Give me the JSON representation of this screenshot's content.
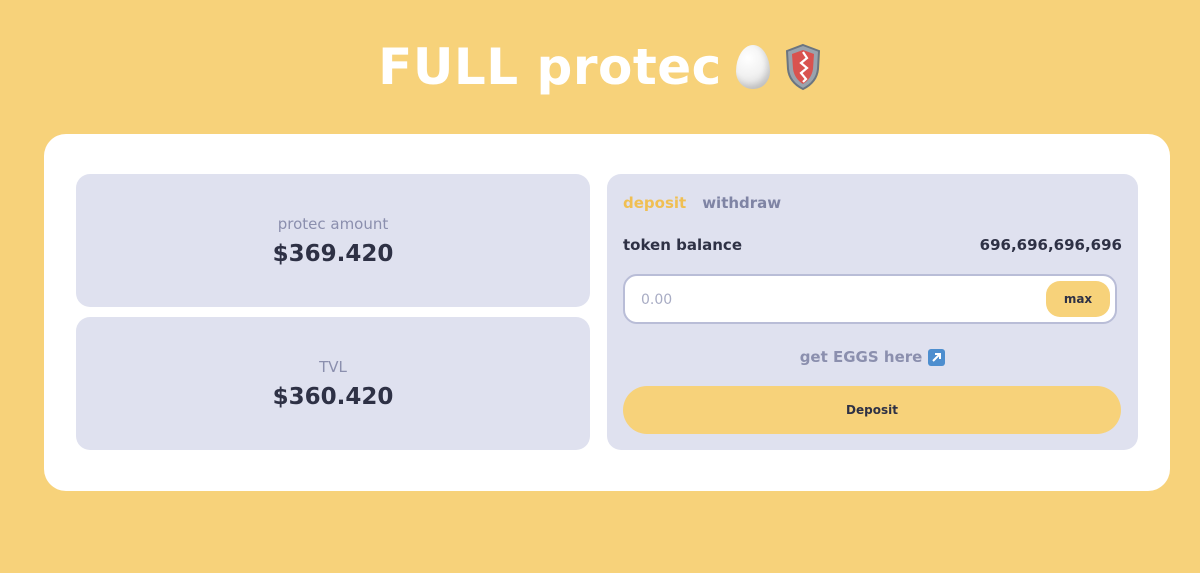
{
  "header": {
    "title": "FULL protec",
    "icons": [
      "egg-icon",
      "shield-icon"
    ]
  },
  "stats": [
    {
      "label": "protec amount",
      "value": "$369.420"
    },
    {
      "label": "TVL",
      "value": "$360.420"
    }
  ],
  "panel": {
    "tabs": [
      {
        "label": "deposit",
        "active": true
      },
      {
        "label": "withdraw",
        "active": false
      }
    ],
    "balance_label": "token balance",
    "balance_value": "696,696,696,696",
    "amount_placeholder": "0.00",
    "max_label": "max",
    "get_link_label": "get EGGS here",
    "get_link_icon": "external-link-arrow-icon",
    "action_label": "Deposit"
  },
  "colors": {
    "background": "#f7d27a",
    "card": "#ffffff",
    "panel": "#dfe1ef",
    "accent": "#f0bf52",
    "text_dark": "#2e3145",
    "text_muted": "#8b8fae"
  }
}
